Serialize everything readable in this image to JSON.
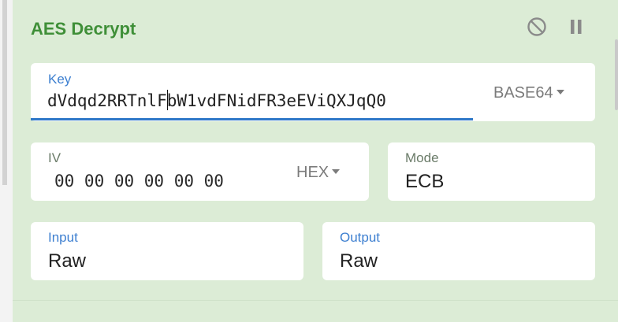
{
  "panel": {
    "title": "AES Decrypt",
    "icons": {
      "disable": "disable-icon",
      "pause": "pause-icon"
    }
  },
  "key": {
    "label": "Key",
    "value_before_cursor": "dVdqd2RRTnlF",
    "value_after_cursor": "bW1vdFNidFR3eEViQXJqQ0",
    "format": "BASE64"
  },
  "iv": {
    "label": "IV",
    "value": "00 00 00 00 00 00",
    "format": "HEX"
  },
  "mode": {
    "label": "Mode",
    "value": "ECB"
  },
  "input": {
    "label": "Input",
    "value": "Raw"
  },
  "output": {
    "label": "Output",
    "value": "Raw"
  },
  "colors": {
    "accent_green": "#3f8f38",
    "panel_bg": "#dcecd6",
    "focus_blue": "#2f78c8"
  }
}
